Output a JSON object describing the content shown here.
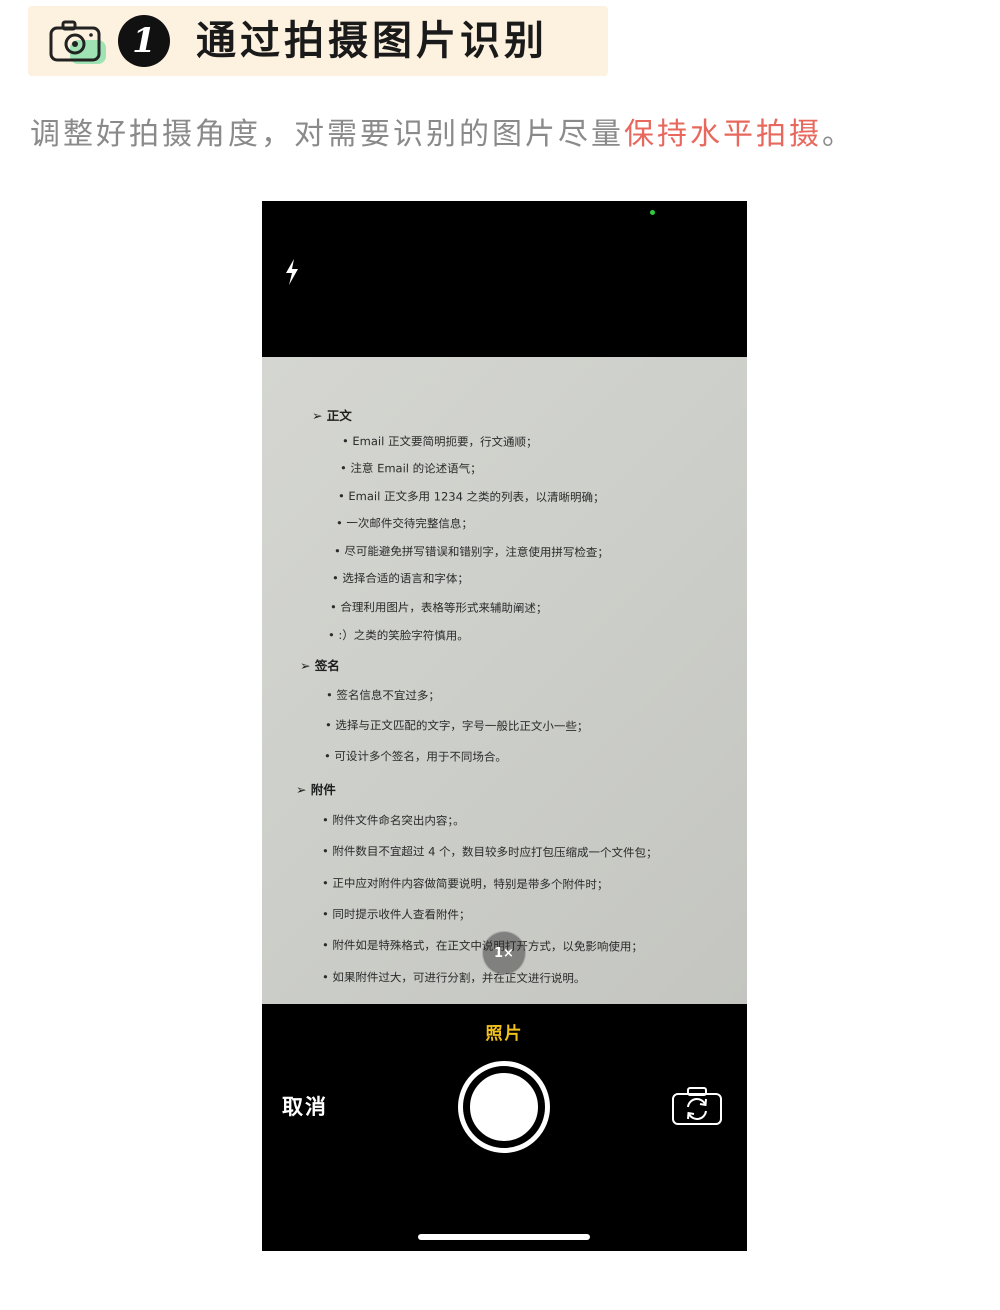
{
  "header": {
    "step_number": "1",
    "title": "通过拍摄图片识别",
    "icon": "camera-icon"
  },
  "instruction": {
    "text_before": "调整好拍摄角度，对需要识别的图片尽量",
    "highlight": "保持水平拍摄",
    "text_after": "。",
    "highlight_color": "#e8685e"
  },
  "camera": {
    "flash_icon": "flash-icon",
    "zoom_label": "1×",
    "mode_label": "照片",
    "cancel_label": "取消",
    "shutter_icon": "shutter-button",
    "flip_icon": "camera-flip-icon"
  },
  "document": {
    "lines": [
      {
        "text": "➢    正文",
        "type": "head"
      },
      {
        "text": "• Email 正文要简明扼要，行文通顺；",
        "type": "item"
      },
      {
        "text": "• 注意 Email 的论述语气；",
        "type": "item"
      },
      {
        "text": "• Email 正文多用 1234 之类的列表，以清晰明确；",
        "type": "item"
      },
      {
        "text": "• 一次邮件交待完整信息；",
        "type": "item"
      },
      {
        "text": "• 尽可能避免拼写错误和错别字，注意使用拼写检查；",
        "type": "item"
      },
      {
        "text": "• 选择合适的语言和字体；",
        "type": "item"
      },
      {
        "text": "• 合理利用图片，表格等形式来辅助阐述；",
        "type": "item"
      },
      {
        "text": "• :）之类的笑脸字符慎用。",
        "type": "item"
      },
      {
        "text": "➢  签名",
        "type": "head"
      },
      {
        "text": "• 签名信息不宜过多；",
        "type": "item"
      },
      {
        "text": "• 选择与正文匹配的文字，字号一般比正文小一些；",
        "type": "item"
      },
      {
        "text": "• 可设计多个签名，用于不同场合。",
        "type": "item"
      },
      {
        "text": "➢  附件",
        "type": "head"
      },
      {
        "text": "• 附件文件命名突出内容；。",
        "type": "item"
      },
      {
        "text": "• 附件数目不宜超过 4 个，数目较多时应打包压缩成一个文件包；",
        "type": "item"
      },
      {
        "text": "• 正中应对附件内容做简要说明，特别是带多个附件时；",
        "type": "item"
      },
      {
        "text": "• 同时提示收件人查看附件；",
        "type": "item"
      },
      {
        "text": "• 附件如是特殊格式，在正文中说明打开方式，以免影响使用；",
        "type": "item"
      },
      {
        "text": "• 如果附件过大，可进行分割，并在正文进行说明。",
        "type": "item"
      }
    ]
  }
}
